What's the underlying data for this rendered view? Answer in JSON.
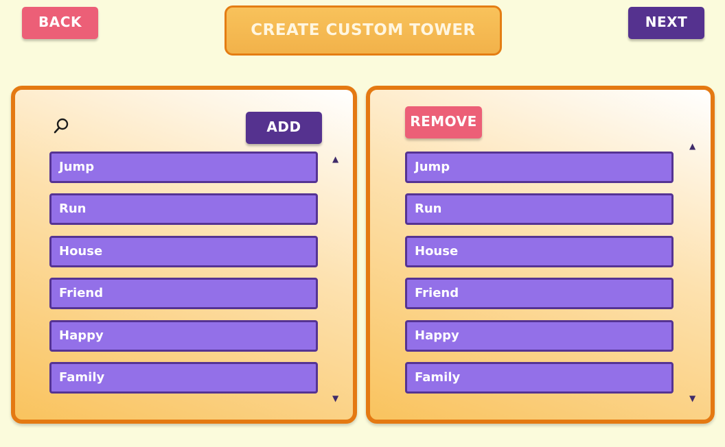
{
  "header": {
    "back_label": "BACK",
    "title": "CREATE CUSTOM TOWER",
    "next_label": "NEXT"
  },
  "left_panel": {
    "search_icon": "search-icon",
    "add_label": "ADD",
    "items": [
      "Jump",
      "Run",
      "House",
      "Friend",
      "Happy",
      "Family"
    ],
    "scroll_up_glyph": "▲",
    "scroll_down_glyph": "▼"
  },
  "right_panel": {
    "remove_label": "REMOVE",
    "items": [
      "Jump",
      "Run",
      "House",
      "Friend",
      "Happy",
      "Family"
    ],
    "scroll_up_glyph": "▲",
    "scroll_down_glyph": "▼"
  },
  "colors": {
    "background": "#fbfbdc",
    "back_button": "#ec5f77",
    "next_button": "#55328f",
    "title_fill": "#f5b953",
    "panel_border": "#e47912",
    "list_item_fill": "#9370e8",
    "list_item_border": "#553393"
  }
}
